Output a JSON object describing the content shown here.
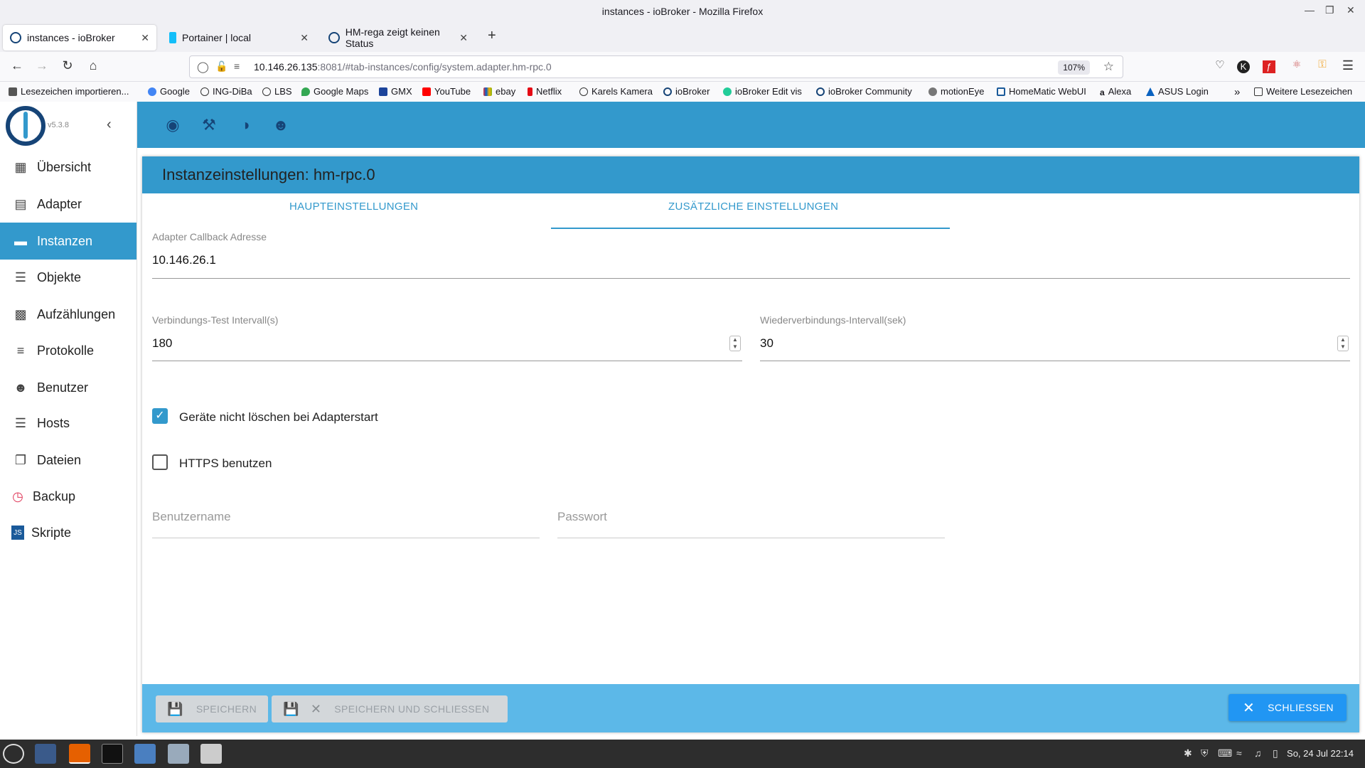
{
  "window": {
    "title": "instances - ioBroker - Mozilla Firefox"
  },
  "tabs": [
    {
      "label": "instances - ioBroker"
    },
    {
      "label": "Portainer | local"
    },
    {
      "label": "HM-rega zeigt keinen Status"
    }
  ],
  "address": {
    "host": "10.146.26.135",
    "rest": ":8081/#tab-instances/config/system.adapter.hm-rpc.0",
    "zoom": "107%"
  },
  "bookmarks": [
    "Lesezeichen importieren...",
    "Google",
    "ING-DiBa",
    "LBS",
    "Google Maps",
    "GMX",
    "YouTube",
    "ebay",
    "Netflix",
    "Karels Kamera",
    "ioBroker",
    "ioBroker Edit vis",
    "ioBroker Community",
    "motionEye",
    "HomeMatic WebUI",
    "Alexa",
    "ASUS Login"
  ],
  "bookmarks_more": "Weitere Lesezeichen",
  "app": {
    "version": "v5.3.8"
  },
  "menu": [
    {
      "label": "Übersicht",
      "icon": "grid-icon"
    },
    {
      "label": "Adapter",
      "icon": "store-icon"
    },
    {
      "label": "Instanzen",
      "icon": "instances-icon",
      "active": true
    },
    {
      "label": "Objekte",
      "icon": "list-icon"
    },
    {
      "label": "Aufzählungen",
      "icon": "enum-icon"
    },
    {
      "label": "Protokolle",
      "icon": "log-icon"
    },
    {
      "label": "Benutzer",
      "icon": "user-icon"
    },
    {
      "label": "Hosts",
      "icon": "hosts-icon"
    },
    {
      "label": "Dateien",
      "icon": "files-icon"
    },
    {
      "label": "Backup",
      "icon": "backup-icon"
    },
    {
      "label": "Skripte",
      "icon": "js-icon"
    }
  ],
  "panel": {
    "title": "Instanzeinstellungen: hm-rpc.0",
    "tab_main": "HAUPTEINSTELLUNGEN",
    "tab_extra": "ZUSÄTZLICHE EINSTELLUNGEN",
    "callback_label": "Adapter Callback Adresse",
    "callback_value": "10.146.26.1",
    "test_label": "Verbindungs-Test Intervall(s)",
    "test_value": "180",
    "reconnect_label": "Wiederverbindungs-Intervall(sek)",
    "reconnect_value": "30",
    "dontdelete_label": "Geräte nicht löschen bei Adapterstart",
    "dontdelete_checked": true,
    "https_label": "HTTPS benutzen",
    "https_checked": false,
    "username_placeholder": "Benutzername",
    "password_placeholder": "Passwort"
  },
  "footer": {
    "save": "SPEICHERN",
    "save_close": "SPEICHERN UND SCHLIESSEN",
    "close": "SCHLIESSEN"
  },
  "taskbar": {
    "clock": "So, 24 Jul 22:14"
  }
}
